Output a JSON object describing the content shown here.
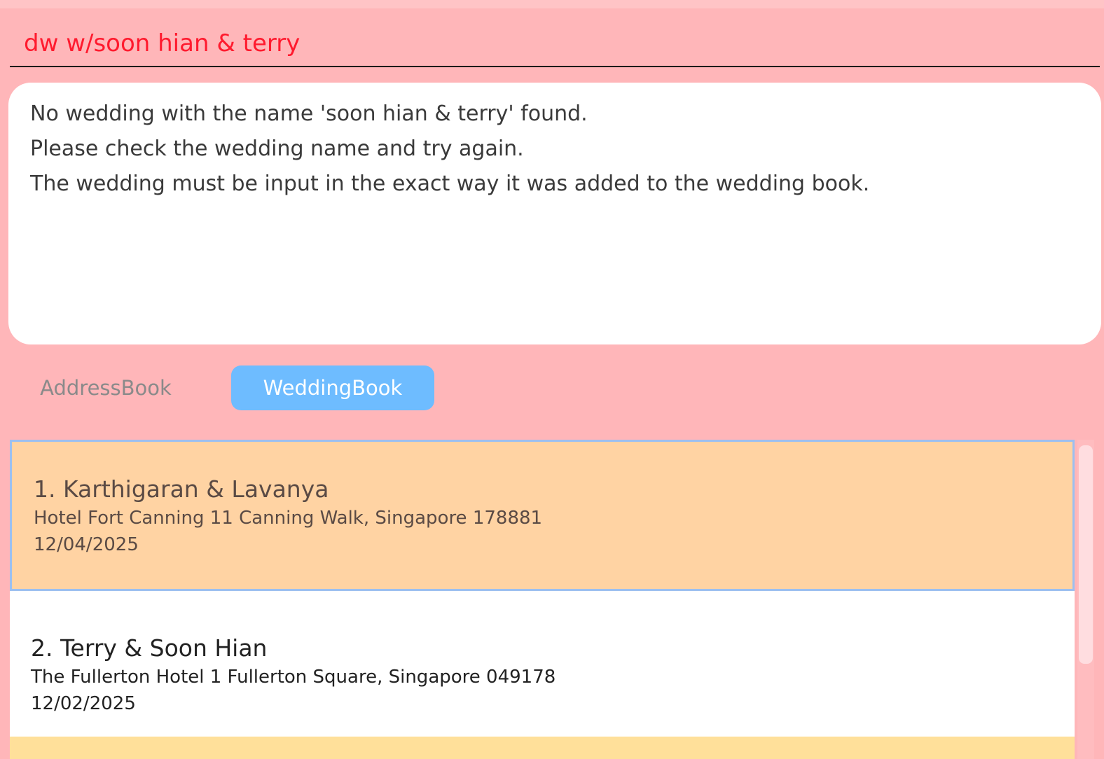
{
  "command": {
    "value": "dw w/soon hian & terry"
  },
  "result": {
    "lines": [
      "No wedding with the name 'soon hian & terry' found.",
      "Please check the wedding name and try again.",
      "The wedding must be input in the exact way it was added to the wedding book."
    ]
  },
  "tabs": [
    {
      "label": "AddressBook",
      "selected": false
    },
    {
      "label": "WeddingBook",
      "selected": true
    }
  ],
  "weddings": [
    {
      "title": "1. Karthigaran & Lavanya",
      "venue": "Hotel Fort Canning 11 Canning Walk, Singapore 178881",
      "date": "12/04/2025"
    },
    {
      "title": "2. Terry & Soon Hian",
      "venue": "The Fullerton Hotel 1 Fullerton Square, Singapore 049178",
      "date": "12/02/2025"
    }
  ],
  "colors": {
    "background": "#ffb6b9",
    "command_text": "#ff1a2e",
    "tab_selected": "#6ebcff",
    "card_selected": "#ffd3a3",
    "card_selected_border": "#9cbff0",
    "card_next": "#ffe09a"
  }
}
